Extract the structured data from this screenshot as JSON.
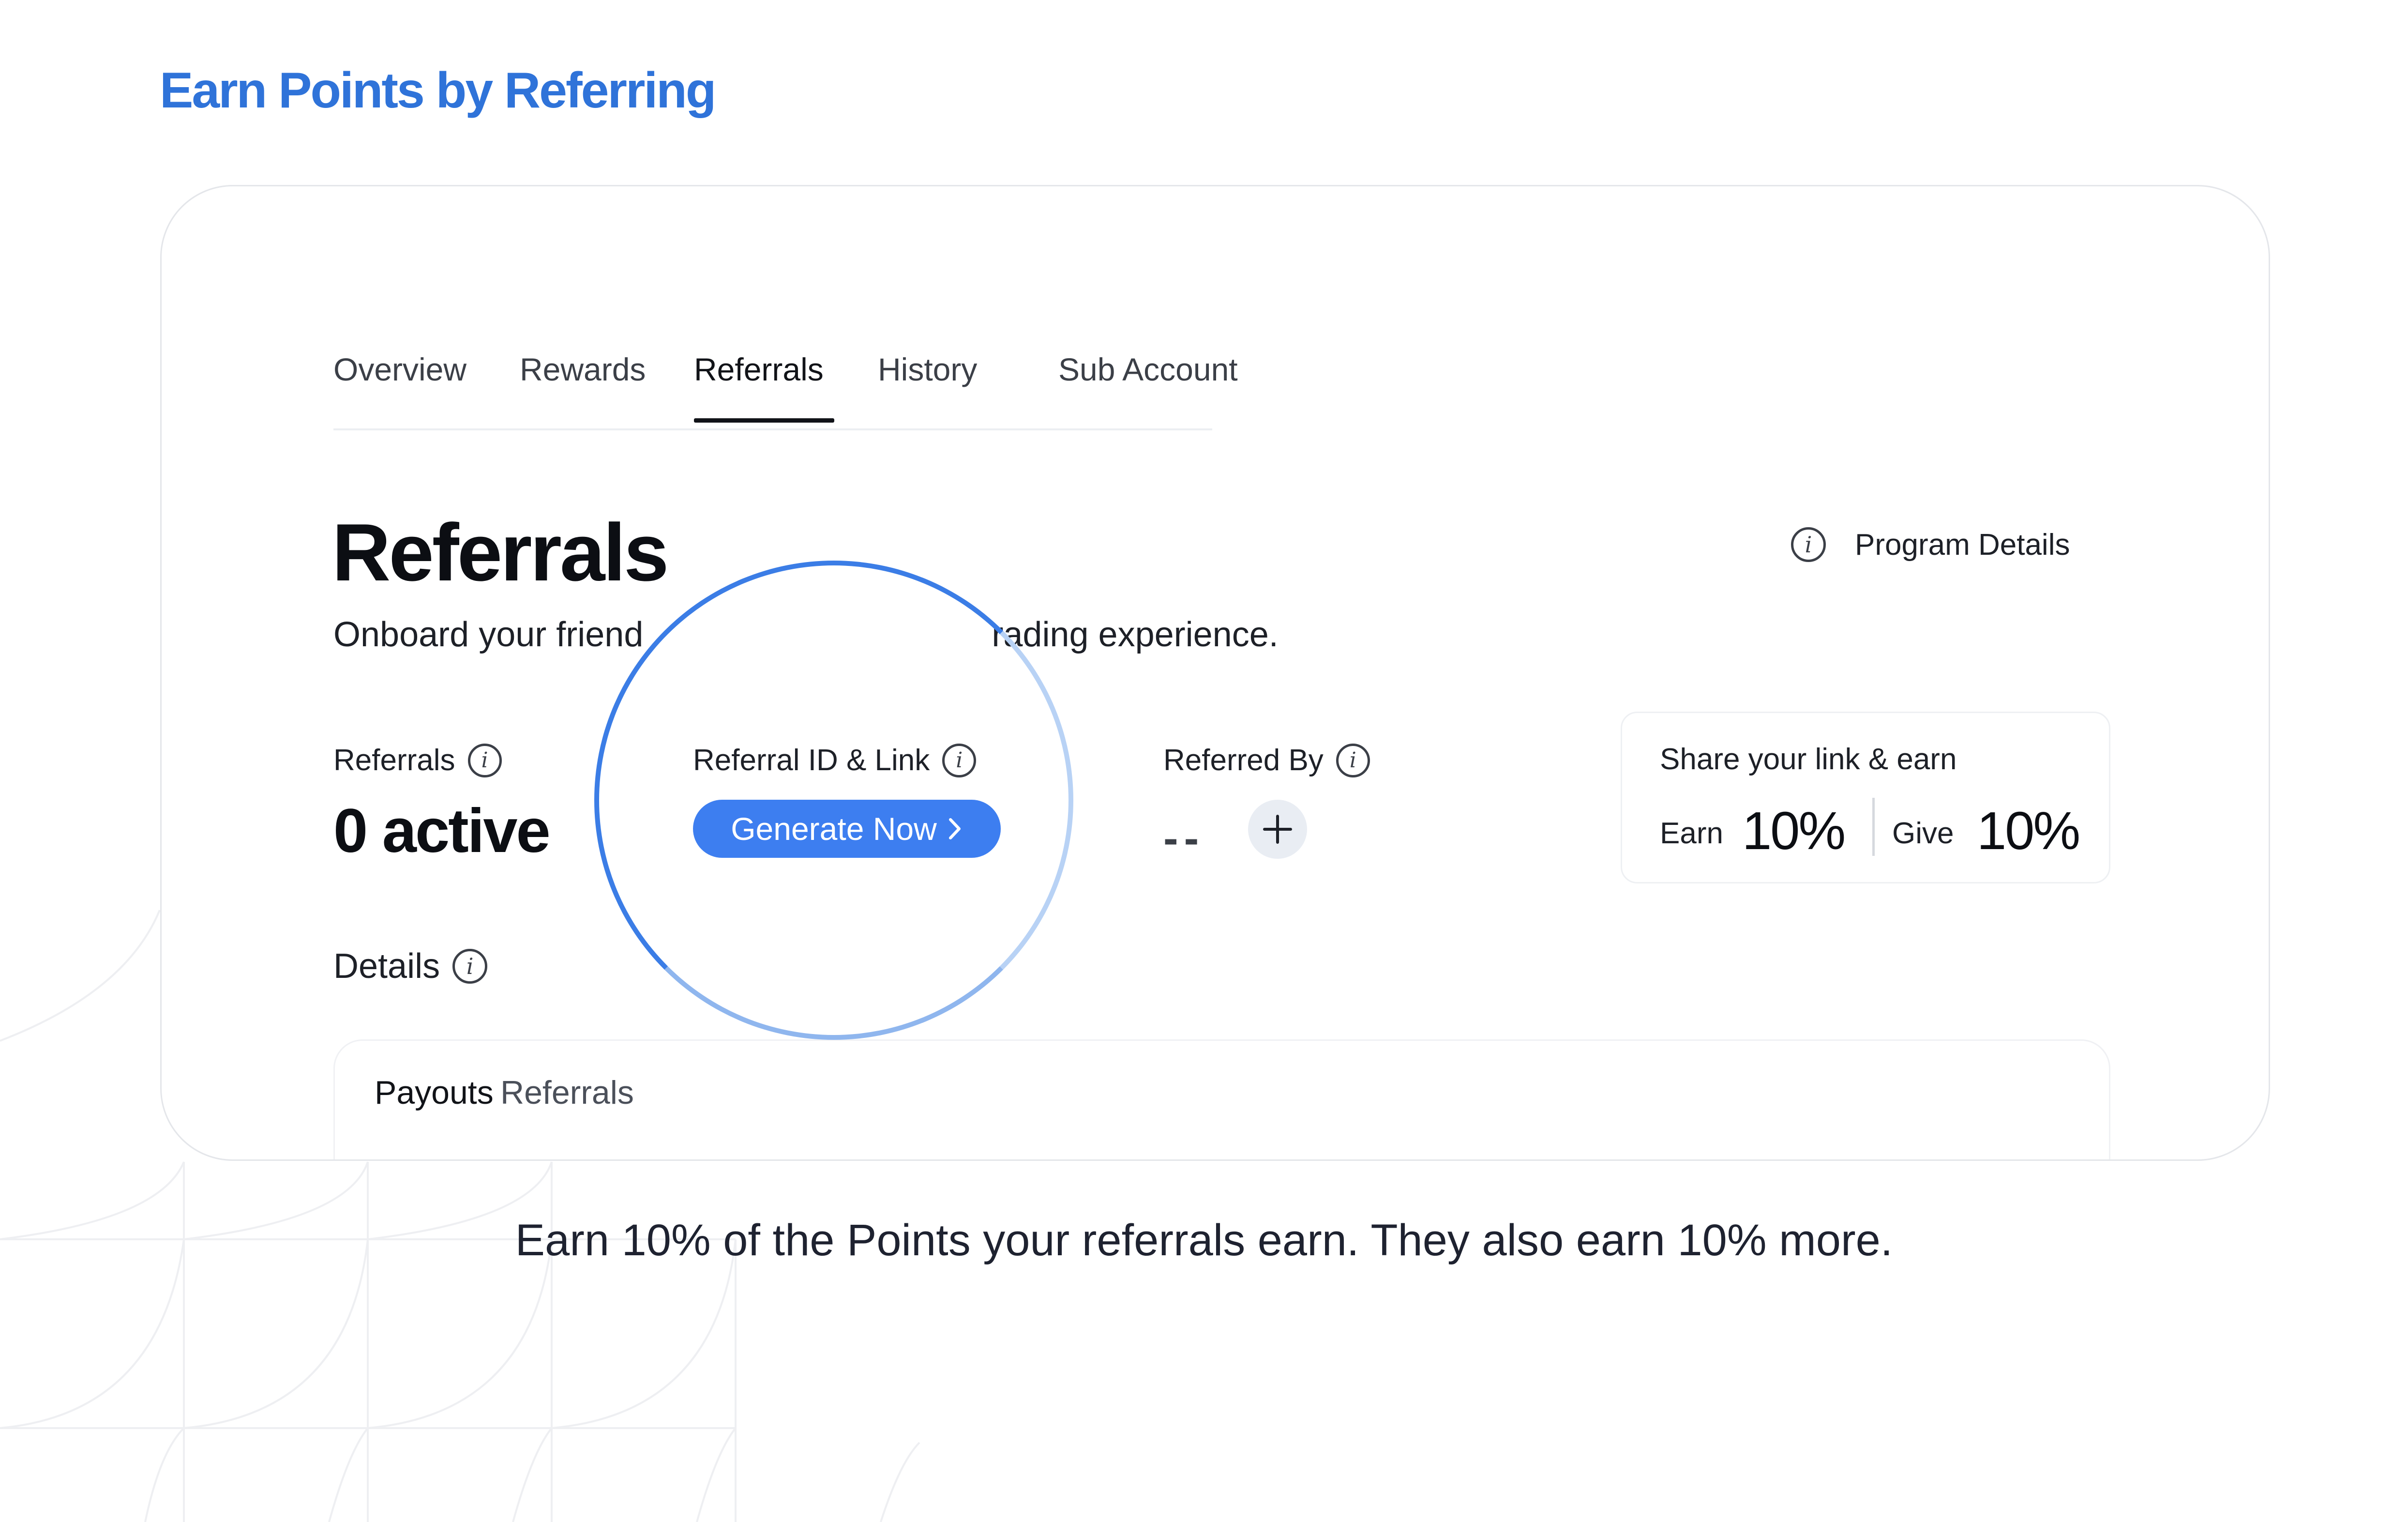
{
  "headline": "Earn Points by Referring",
  "tabs": [
    {
      "label": "Overview"
    },
    {
      "label": "Rewards"
    },
    {
      "label": "Referrals"
    },
    {
      "label": "History"
    },
    {
      "label": "Sub Account"
    }
  ],
  "active_tab": "Referrals",
  "page": {
    "title": "Referrals",
    "subtitle_start": "Onboard your friend",
    "subtitle_end": "rading experience.",
    "program_details_label": "Program Details"
  },
  "stats": {
    "referrals_label": "Referrals",
    "referrals_value": "0 active",
    "referral_id_label": "Referral ID & Link",
    "generate_button_label": "Generate Now",
    "referred_by_label": "Referred By",
    "referred_by_value": "--"
  },
  "share": {
    "title": "Share your link & earn",
    "earn_label": "Earn",
    "earn_value": "10%",
    "give_label": "Give",
    "give_value": "10%"
  },
  "details": {
    "label": "Details",
    "subtabs": [
      {
        "label": "Payouts"
      },
      {
        "label": "Referrals"
      }
    ],
    "active_subtab": "Payouts"
  },
  "footer_text": "Earn 10% of the Points your referrals earn. They also earn 10% more.",
  "colors": {
    "brand_blue": "#2f73d9",
    "button_blue": "#3d7ef0",
    "text_dark": "#0c0e13"
  },
  "icons": [
    "info-icon",
    "chevron-right-icon",
    "plus-icon"
  ]
}
